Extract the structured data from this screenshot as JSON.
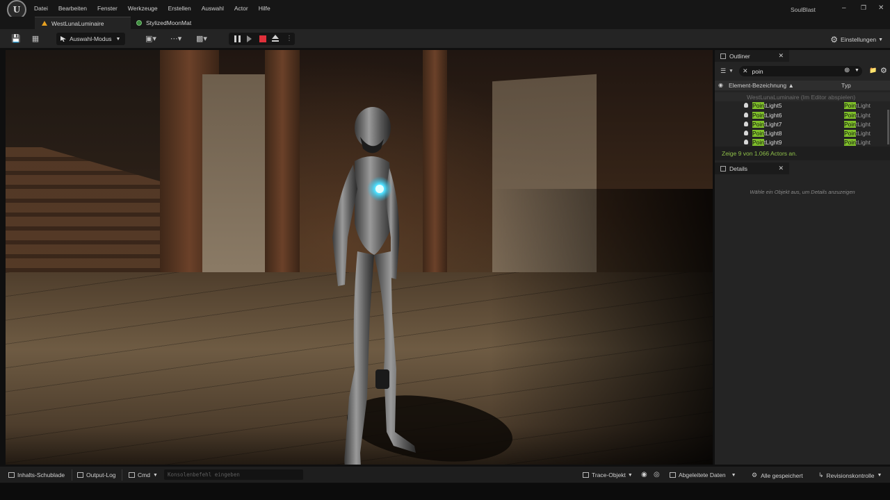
{
  "titlebar": {
    "menu": [
      "Datei",
      "Bearbeiten",
      "Fenster",
      "Werkzeuge",
      "Erstellen",
      "Auswahl",
      "Actor",
      "Hilfe"
    ],
    "app_name": "SoulBlast",
    "logo": "U"
  },
  "tabs": [
    {
      "label": "WestLunaLuminaire",
      "icon": "level-icon",
      "active": true
    },
    {
      "label": "StylizedMoonMat",
      "icon": "material-icon",
      "active": false
    }
  ],
  "toolbar": {
    "mode_label": "Auswahl-Modus",
    "settings_label": "Einstellungen",
    "stop_color": "#e0303a"
  },
  "outliner": {
    "tab_label": "Outliner",
    "search_value": "poin",
    "column_name": "Element-Bezeichnung",
    "column_type": "Typ",
    "level_row": "WestLunaLuminaire (Im Editor abspielen)",
    "rows": [
      {
        "hl": "Poin",
        "rest": "tLight5",
        "type_hl": "Poin",
        "type_rest": "tLight"
      },
      {
        "hl": "Poin",
        "rest": "tLight6",
        "type_hl": "Poin",
        "type_rest": "tLight"
      },
      {
        "hl": "Poin",
        "rest": "tLight7",
        "type_hl": "Poin",
        "type_rest": "tLight"
      },
      {
        "hl": "Poin",
        "rest": "tLight8",
        "type_hl": "Poin",
        "type_rest": "tLight"
      },
      {
        "hl": "Poin",
        "rest": "tLight9",
        "type_hl": "Poin",
        "type_rest": "tLight"
      }
    ],
    "status": "Zeige 9 von 1.066 Actors an.",
    "highlight_color": "#7fbf2a"
  },
  "details": {
    "tab_label": "Details",
    "empty_text": "Wähle ein Objekt aus, um Details anzuzeigen"
  },
  "bottombar": {
    "content_drawer": "Inhalts-Schublade",
    "output_log": "Output-Log",
    "cmd": "Cmd",
    "console_placeholder": "Konsolenbefehl eingeben",
    "trace": "Trace-Objekt",
    "derived_data": "Abgeleitete Daten",
    "saved": "Alle gespeichert",
    "revision": "Revisionskontrolle"
  }
}
